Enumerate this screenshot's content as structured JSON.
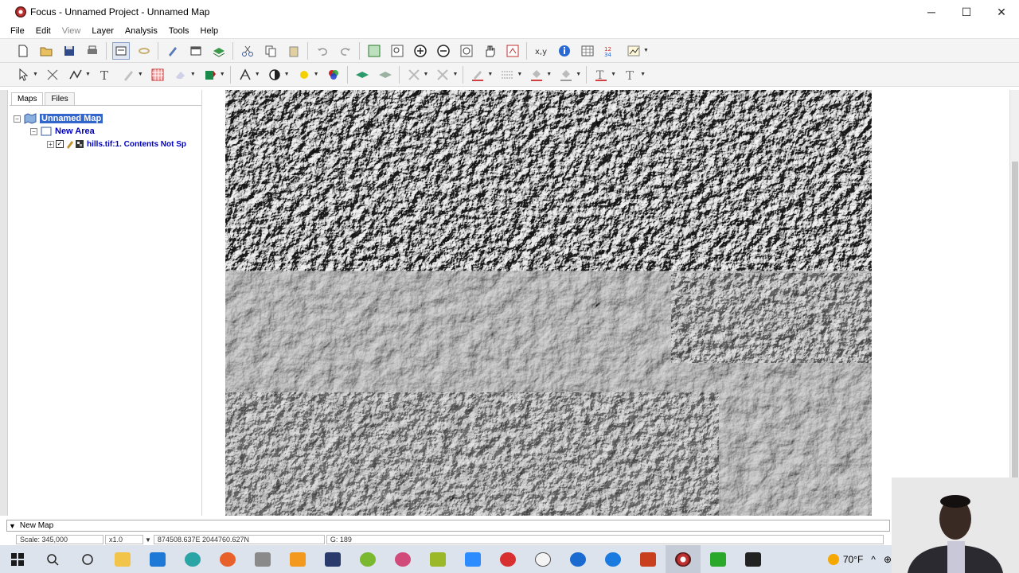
{
  "window": {
    "title": "Focus - Unnamed Project - Unnamed Map",
    "controls": [
      "─",
      "☐",
      "✕"
    ]
  },
  "menu": [
    "File",
    "Edit",
    "View",
    "Layer",
    "Analysis",
    "Tools",
    "Help"
  ],
  "panel": {
    "tabs": [
      "Maps",
      "Files"
    ],
    "tree": {
      "map": "Unnamed Map",
      "area": "New Area",
      "layer": "hills.tif:1. Contents Not Sp"
    }
  },
  "layer_bar": {
    "label": "New Map"
  },
  "status": {
    "scale": "Scale: 345,000",
    "zoom": "x1.0",
    "coords": "874508.637E 2044760.627N",
    "value": "G: 189"
  },
  "taskbar": {
    "weather": "70°F",
    "apps": [
      "search-icon",
      "cortana-icon",
      "file-explorer-icon",
      "store-icon",
      "globe-icon",
      "firefox-icon",
      "app-icon",
      "lm-icon",
      "app-icon",
      "green-icon",
      "edge-icon",
      "app-icon",
      "zoom-icon",
      "app-icon",
      "app-icon",
      "powerpoint-icon",
      "focus-icon",
      "green-c-icon",
      "c-icon"
    ]
  },
  "colors": {
    "selected": "#3366cc",
    "tree_label": "#0000c0",
    "taskbar": "#dde3ec"
  }
}
